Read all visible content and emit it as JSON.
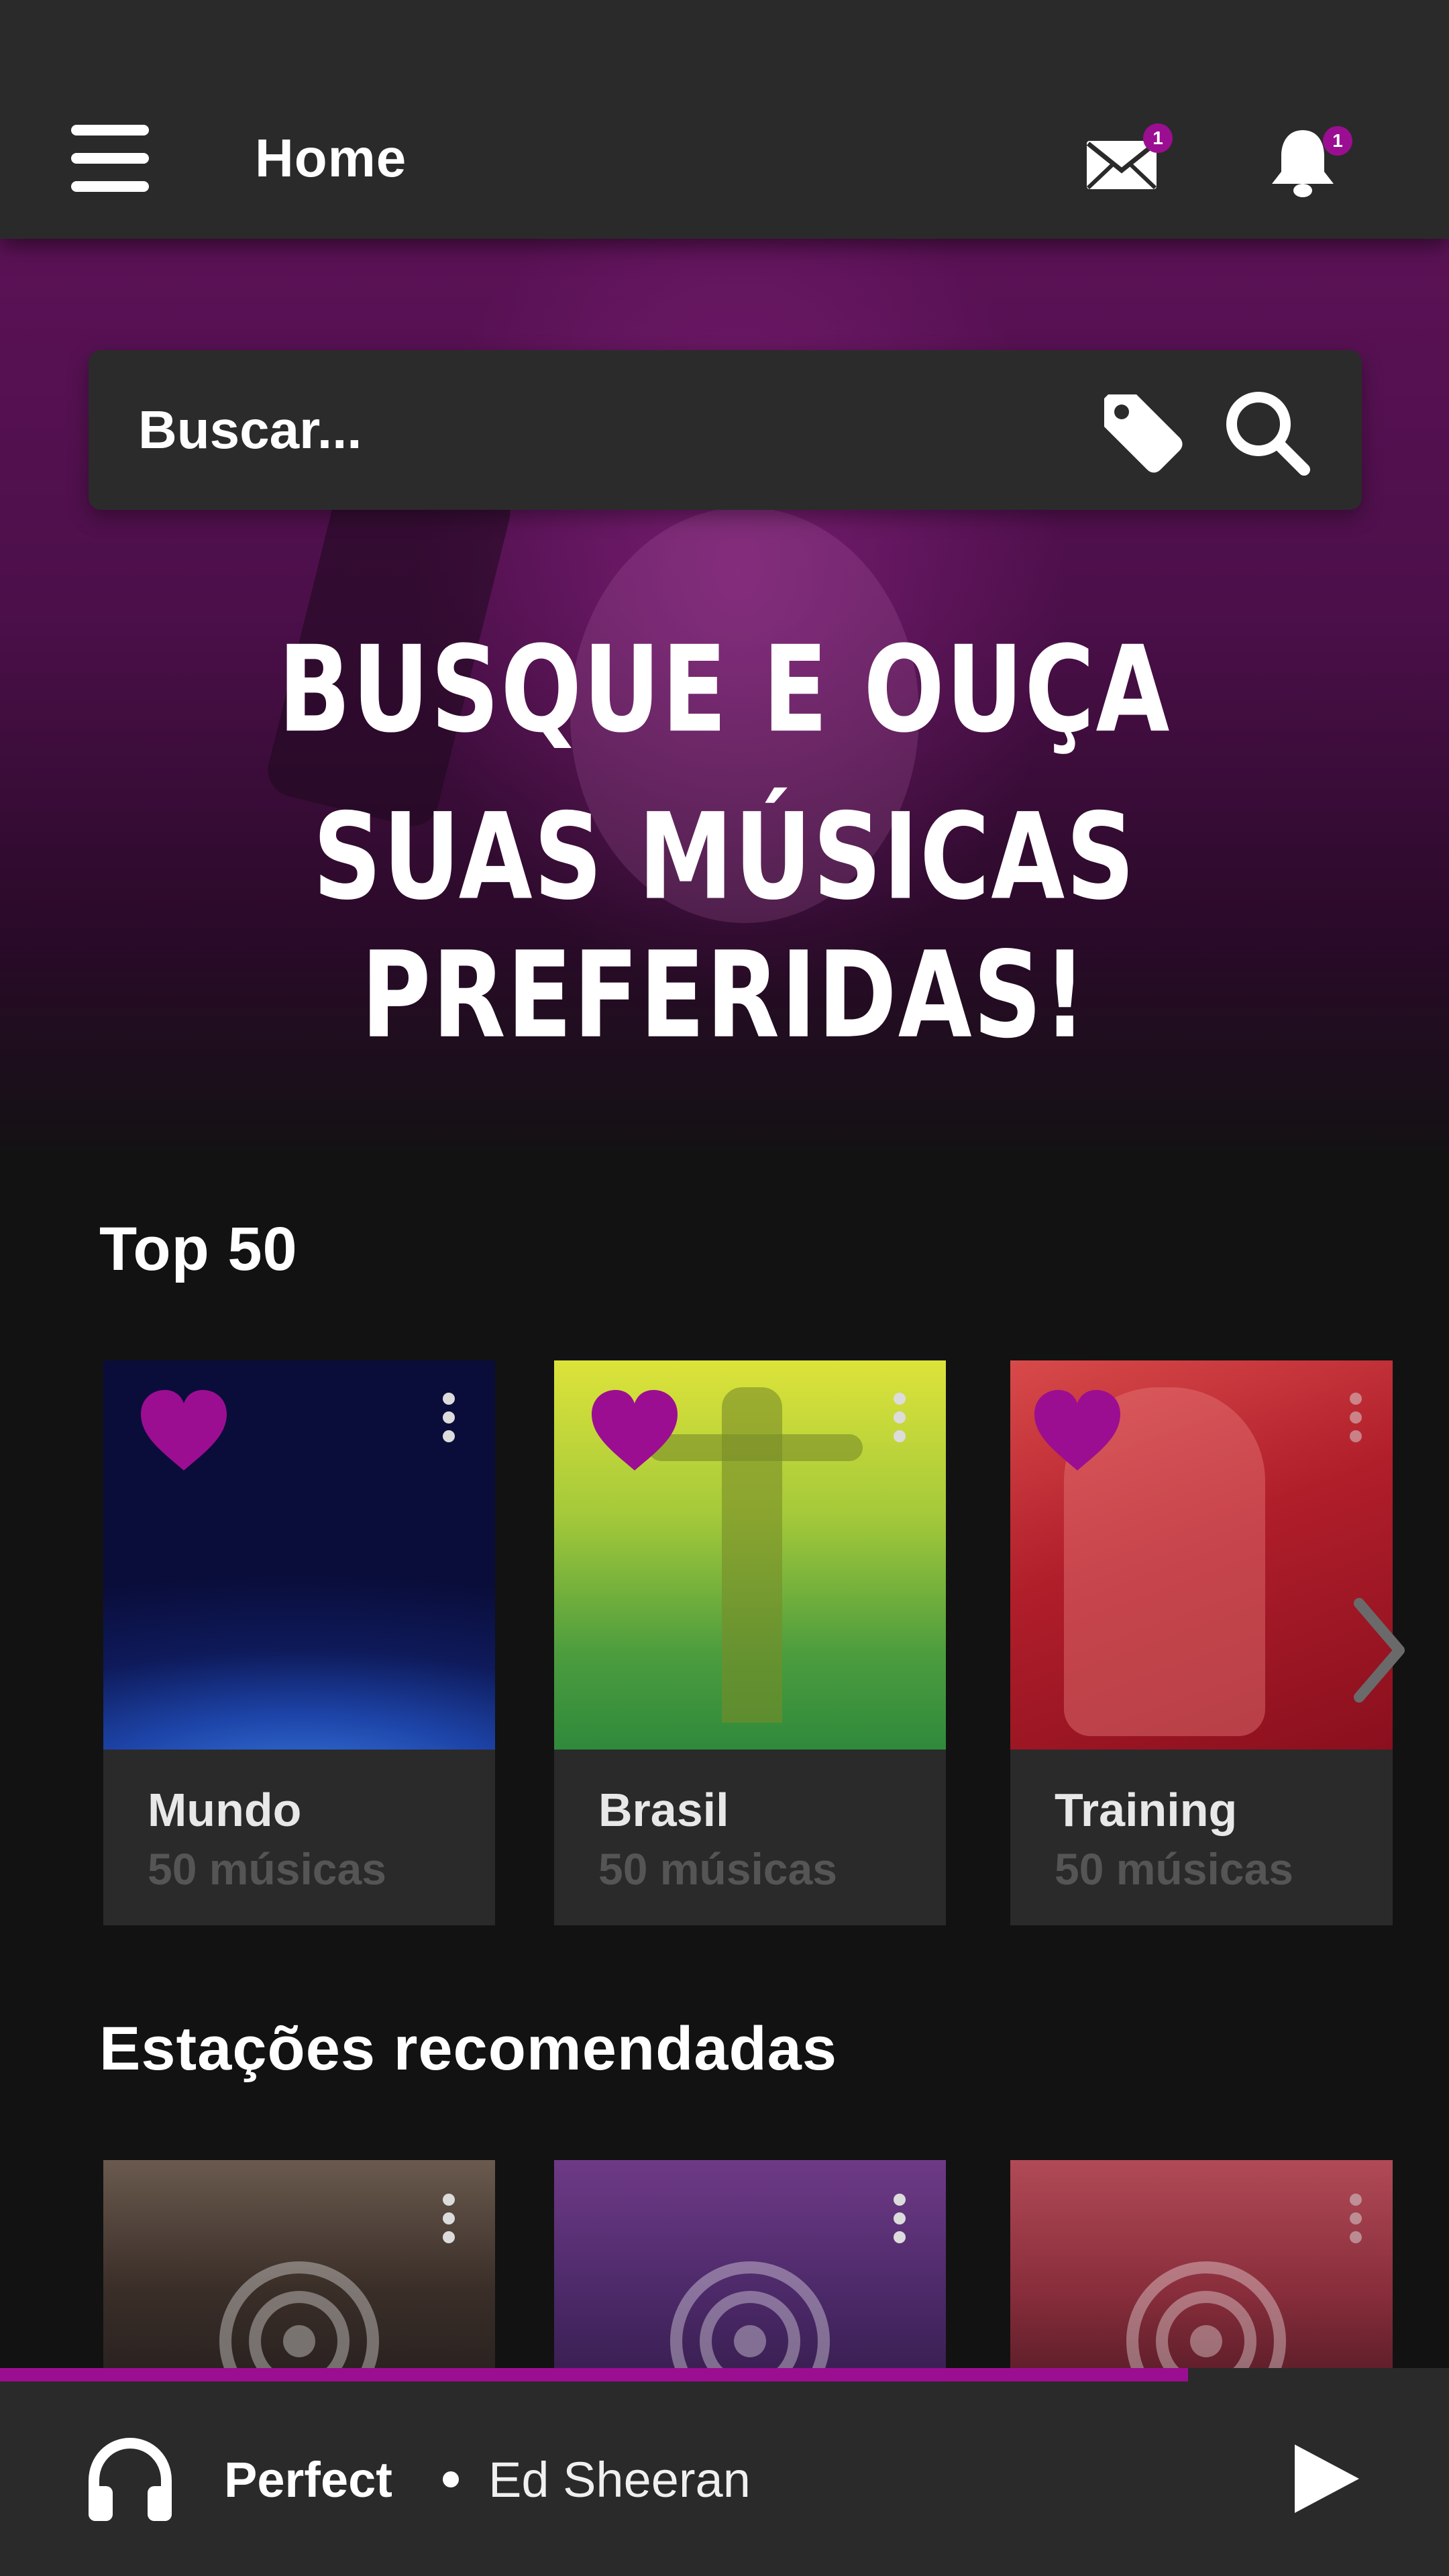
{
  "header": {
    "title": "Home",
    "messages_badge": "1",
    "notifications_badge": "1",
    "icons": [
      "menu-icon",
      "mail-icon",
      "bell-icon"
    ]
  },
  "search": {
    "placeholder": "Buscar...",
    "icons": [
      "tag-icon",
      "search-icon"
    ]
  },
  "hero": {
    "line1": "BUSQUE E OUÇA",
    "line2": "SUAS MÚSICAS PREFERIDAS!"
  },
  "top50": {
    "title": "Top 50",
    "cards": [
      {
        "name": "Mundo",
        "count": "50 músicas",
        "favorited": true
      },
      {
        "name": "Brasil",
        "count": "50 músicas",
        "favorited": true
      },
      {
        "name": "Training",
        "count": "50 músicas",
        "favorited": true
      }
    ]
  },
  "stations": {
    "title": "Estações recomendadas",
    "count_visible": 3
  },
  "player": {
    "song": "Perfect",
    "artist": "Ed Sheeran",
    "progress": 0.82
  },
  "colors": {
    "accent": "#9b0e91",
    "background": "#121212",
    "surface": "#2a2a2a"
  }
}
